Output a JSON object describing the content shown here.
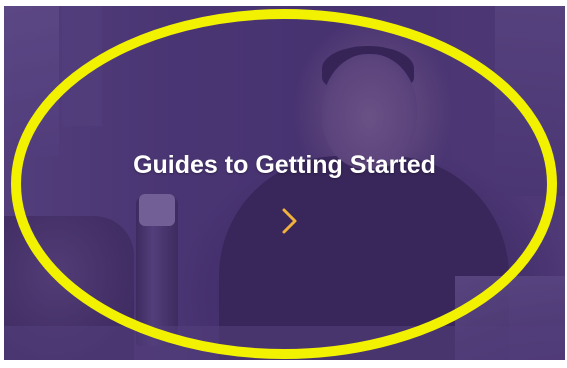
{
  "card": {
    "title": "Guides to Getting Started",
    "chevron_icon": "chevron-right-icon"
  },
  "colors": {
    "overlay": "#4b3870",
    "title_text": "#ffffff",
    "chevron": "#f2b13c",
    "highlight_ring": "#f2f200"
  }
}
